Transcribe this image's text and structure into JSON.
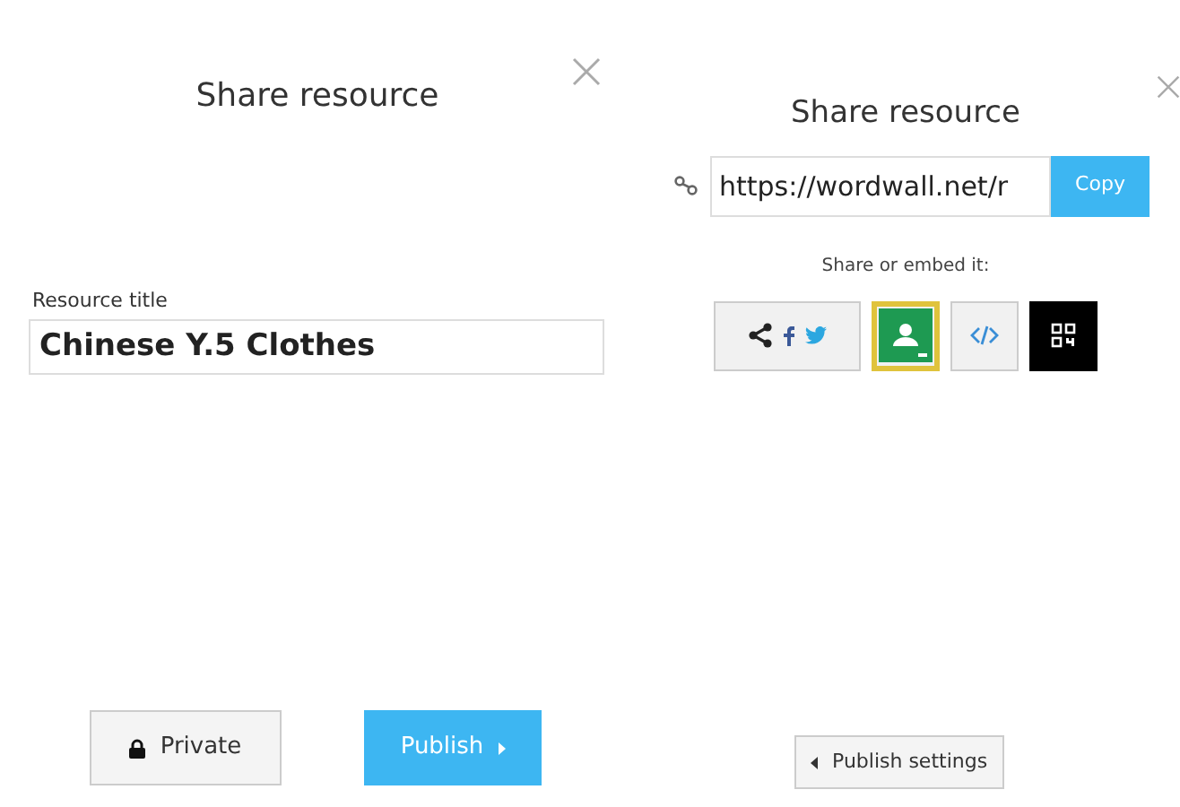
{
  "left_panel": {
    "title": "Share resource",
    "field_label": "Resource title",
    "title_value": "Chinese Y.5 Clothes",
    "buttons": [
      {
        "kind": "private",
        "label": "Private"
      },
      {
        "kind": "publish",
        "label": "Publish"
      }
    ]
  },
  "right_panel": {
    "title": "Share resource",
    "link_value": "https://wordwall.net/r",
    "copy_button": "Copy",
    "share_label": "Share or embed it:",
    "share_options": [
      {
        "kind": "social",
        "selected": false
      },
      {
        "kind": "classroom",
        "selected": true
      },
      {
        "kind": "embed",
        "selected": false
      },
      {
        "kind": "qr",
        "selected": false
      }
    ],
    "back_button": "Publish settings"
  }
}
